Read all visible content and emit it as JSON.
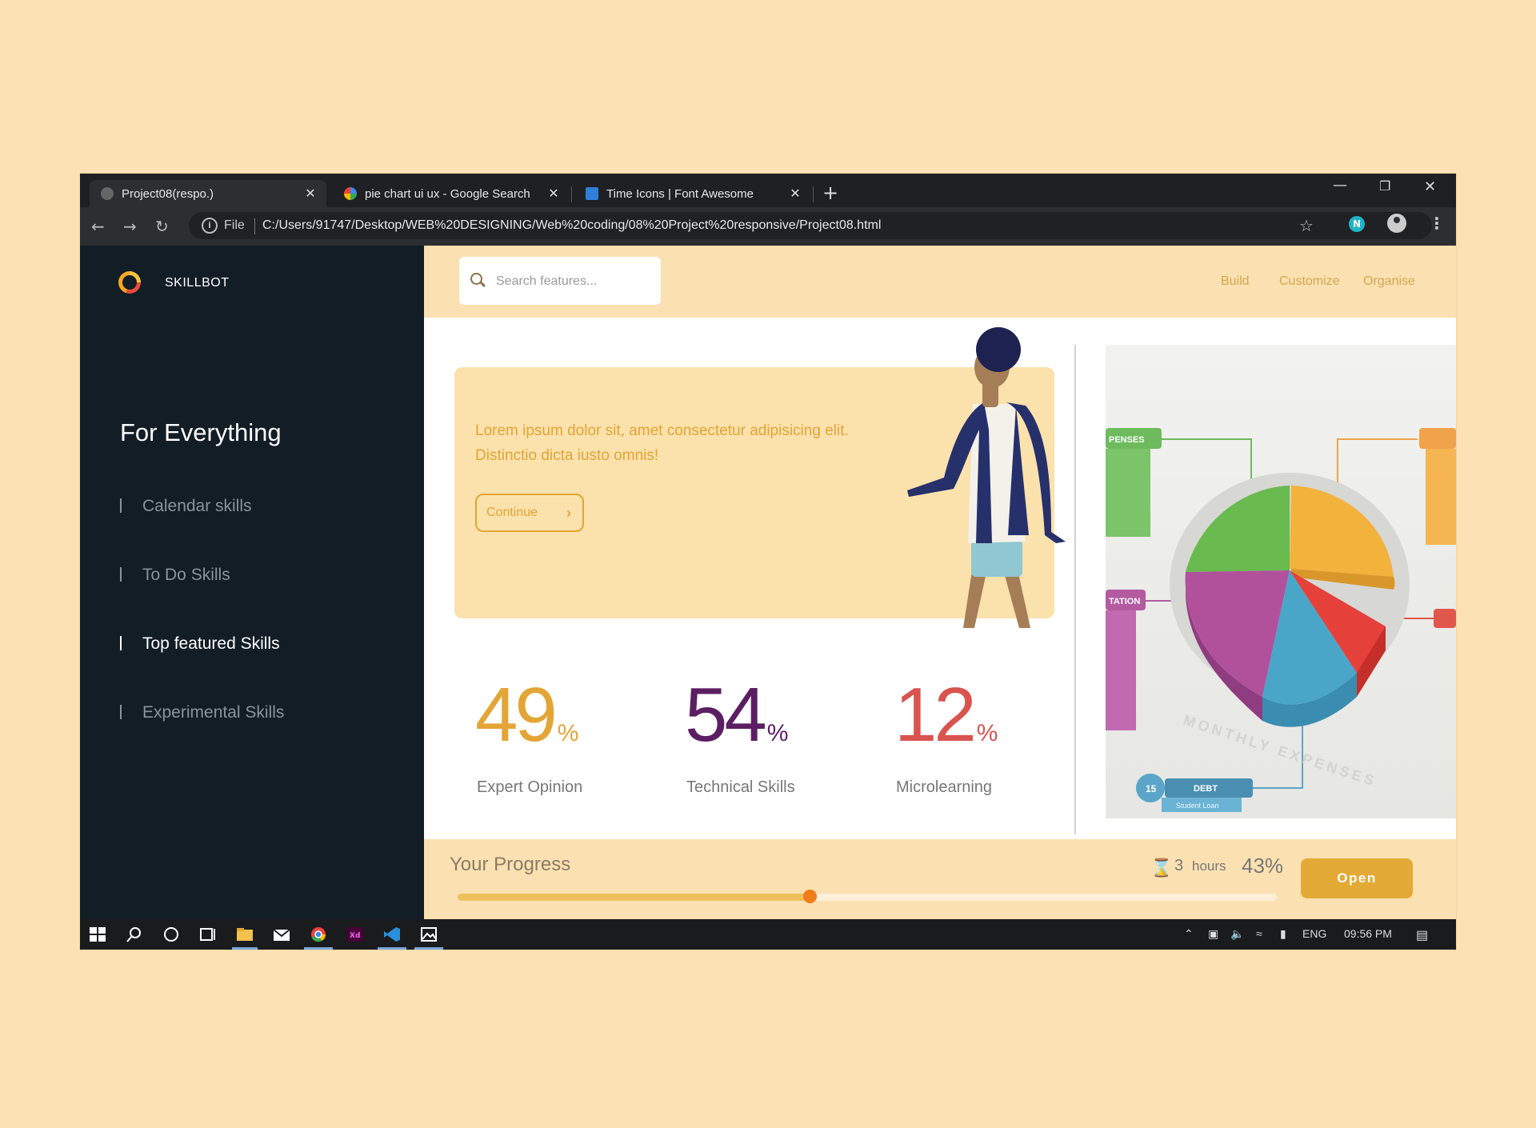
{
  "browser": {
    "tabs": [
      {
        "title": "Project08(respo.)",
        "favicon": "globe-icon",
        "active": true
      },
      {
        "title": "pie chart ui ux - Google Search",
        "favicon": "google-icon",
        "active": false
      },
      {
        "title": "Time Icons | Font Awesome",
        "favicon": "flag-icon",
        "active": false
      }
    ],
    "close_glyph": "✕",
    "new_tab_glyph": "+",
    "file_label": "File",
    "url": "C:/Users/91747/Desktop/WEB%20DESIGNING/Web%20coding/08%20Project%20responsive/Project08.html",
    "extension_badge": "N"
  },
  "sidebar": {
    "brand": "SKILLBOT",
    "title": "For Everything",
    "items": [
      {
        "label": "Calendar skills",
        "active": false
      },
      {
        "label": "To Do Skills",
        "active": false
      },
      {
        "label": "Top featured Skills",
        "active": true
      },
      {
        "label": "Experimental Skills",
        "active": false
      }
    ]
  },
  "header": {
    "search_placeholder": "Search features...",
    "links": [
      "Build",
      "Customize",
      "Organise"
    ]
  },
  "hero": {
    "text": "Lorem ipsum dolor sit, amet consectetur adipisicing elit. Distinctio dicta iusto omnis!",
    "button_label": "Continue"
  },
  "stats": [
    {
      "value": "49",
      "unit": "%",
      "label": "Expert Opinion",
      "color": "#e3a535"
    },
    {
      "value": "54",
      "unit": "%",
      "label": "Technical Skills",
      "color": "#5b1e62"
    },
    {
      "value": "12",
      "unit": "%",
      "label": "Microlearning",
      "color": "#d9544f"
    }
  ],
  "illustration": {
    "labels": [
      "PENSES",
      "TATION",
      "DEBT",
      "Student Loan",
      "15",
      "MONTHLY EXPENSES"
    ]
  },
  "progress": {
    "title": "Your Progress",
    "hours_value": "3",
    "hours_unit": "hours",
    "percent_label": "43%",
    "percent": 0.43,
    "button_label": "Open"
  },
  "taskbar": {
    "lang": "ENG",
    "time": "09:56 PM"
  },
  "colors": {
    "accent": "#e3a535",
    "sidebar_bg": "#131d26",
    "strip_bg": "#fbe1b1",
    "knob": "#f07c1a"
  }
}
